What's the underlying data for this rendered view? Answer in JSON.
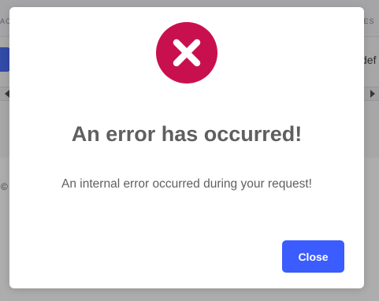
{
  "background": {
    "header_left_fragment": "AC",
    "header_right_fragment": "RES",
    "cell_right_fragment": "def",
    "footer_fragment": "©"
  },
  "dialog": {
    "icon": "error-x-circle-icon",
    "icon_color": "#c9104f",
    "title": "An error has occurred!",
    "message": "An internal error occurred during your request!",
    "close_label": "Close",
    "button_color": "#3b5cff"
  }
}
